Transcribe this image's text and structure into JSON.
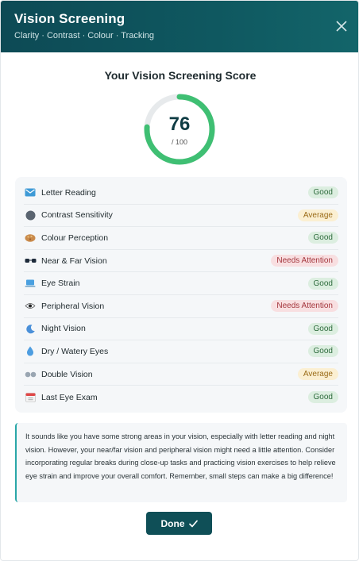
{
  "header": {
    "title": "Vision Screening",
    "subtitle": "Clarity · Contrast · Colour · Tracking"
  },
  "score": {
    "heading": "Your Vision Screening Score",
    "value": "76",
    "out_of": "/ 100",
    "fraction": 0.76,
    "ring_color": "#3fbf73",
    "track_color": "#e7eaec"
  },
  "checks": [
    {
      "label": "Letter Reading",
      "status": "Good",
      "level": "good",
      "icon": "envelope-icon"
    },
    {
      "label": "Contrast Sensitivity",
      "status": "Average",
      "level": "avg",
      "icon": "contrast-circle-icon"
    },
    {
      "label": "Colour Perception",
      "status": "Good",
      "level": "good",
      "icon": "palette-icon"
    },
    {
      "label": "Near & Far Vision",
      "status": "Needs Attention",
      "level": "attn",
      "icon": "glasses-icon"
    },
    {
      "label": "Eye Strain",
      "status": "Good",
      "level": "good",
      "icon": "laptop-icon"
    },
    {
      "label": "Peripheral Vision",
      "status": "Needs Attention",
      "level": "attn",
      "icon": "eye-icon"
    },
    {
      "label": "Night Vision",
      "status": "Good",
      "level": "good",
      "icon": "moon-icon"
    },
    {
      "label": "Dry / Watery Eyes",
      "status": "Good",
      "level": "good",
      "icon": "droplet-icon"
    },
    {
      "label": "Double Vision",
      "status": "Average",
      "level": "avg",
      "icon": "double-circle-icon"
    },
    {
      "label": "Last Eye Exam",
      "status": "Good",
      "level": "good",
      "icon": "calendar-icon"
    }
  ],
  "summary": "It sounds like you have some strong areas in your vision, especially with letter reading and night vision. However, your near/far vision and peripheral vision might need a little attention. Consider incorporating regular breaks during close-up tasks and practicing vision exercises to help relieve eye strain and improve your overall comfort. Remember, small steps can make a big difference!",
  "done_label": "Done",
  "colors": {
    "header": "#0f5860",
    "good": "#2c6a3b",
    "average": "#9a6b17",
    "attention": "#a4363d",
    "accent": "#2aa7a8"
  }
}
